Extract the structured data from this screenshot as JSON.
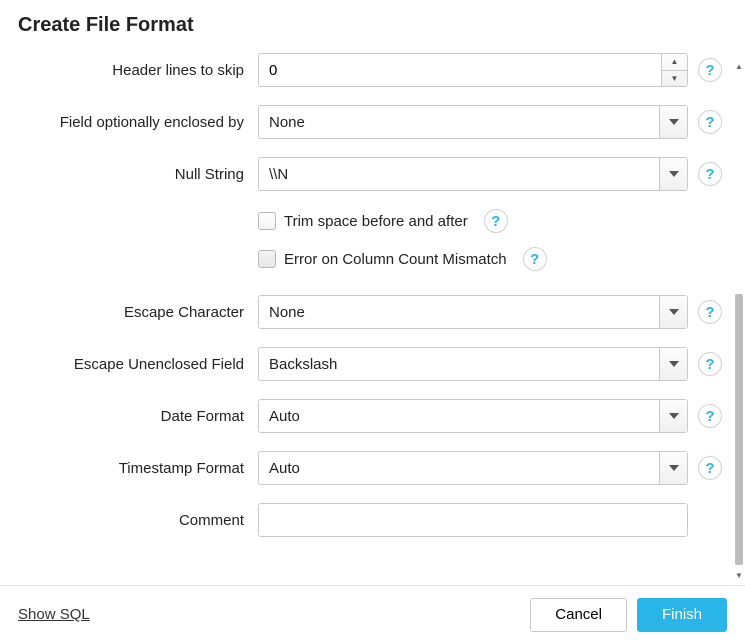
{
  "title": "Create File Format",
  "fields": {
    "header_lines": {
      "label": "Header lines to skip",
      "value": "0"
    },
    "enclosed_by": {
      "label": "Field optionally enclosed by",
      "value": "None"
    },
    "null_string": {
      "label": "Null String",
      "value": "\\\\N"
    },
    "trim_space": {
      "label": "Trim space before and after",
      "checked": false
    },
    "error_mismatch": {
      "label": "Error on Column Count Mismatch",
      "checked": false
    },
    "escape_char": {
      "label": "Escape Character",
      "value": "None"
    },
    "escape_unenclosed": {
      "label": "Escape Unenclosed Field",
      "value": "Backslash"
    },
    "date_format": {
      "label": "Date Format",
      "value": "Auto"
    },
    "timestamp_format": {
      "label": "Timestamp Format",
      "value": "Auto"
    },
    "comment": {
      "label": "Comment",
      "value": ""
    }
  },
  "help_glyph": "?",
  "footer": {
    "show_sql": "Show SQL",
    "cancel": "Cancel",
    "finish": "Finish"
  }
}
